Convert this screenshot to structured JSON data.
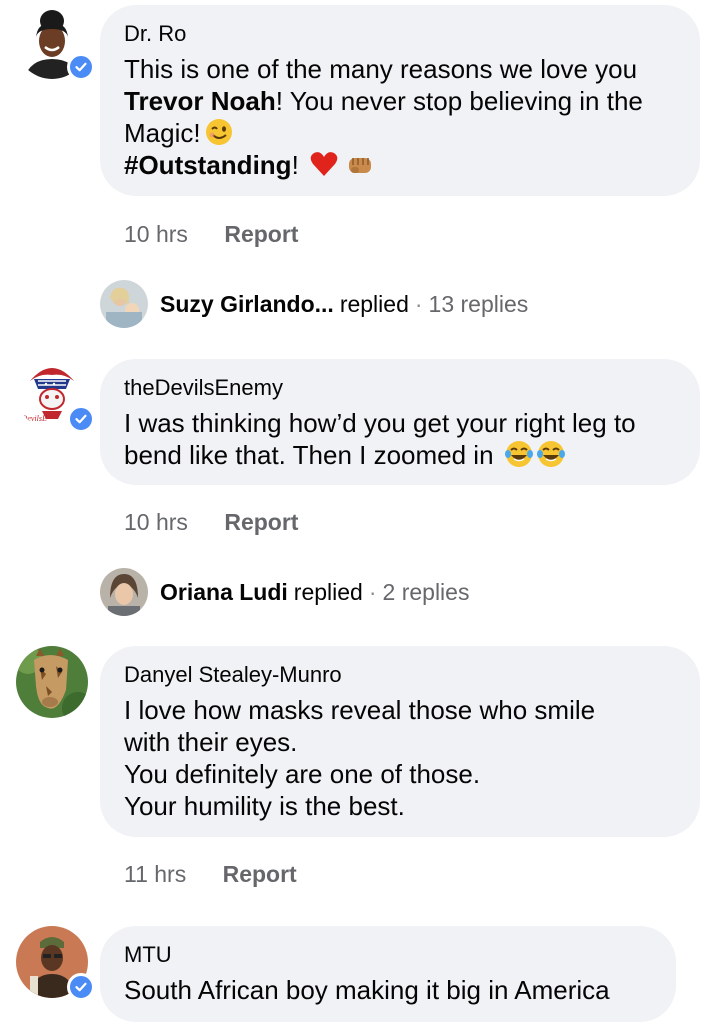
{
  "comments": [
    {
      "author": "Dr. Ro",
      "verified": true,
      "lines": [
        {
          "pre": "This is one of the many reasons we love you ",
          "bold": "",
          "post": ""
        },
        {
          "pre": "",
          "bold": "Trevor Noah",
          "post": "! You never stop believing in the"
        },
        {
          "pre": "Magic!",
          "bold": "",
          "post": ""
        },
        {
          "pre": "",
          "bold": "#Outstanding",
          "post": "!"
        }
      ],
      "emojis": [
        "wink-emoji",
        "red-heart-emoji",
        "fist-emoji"
      ],
      "time": "10 hrs",
      "report": "Report",
      "reply_summary": {
        "name": "Suzy Girlando...",
        "verb": "replied",
        "dot": "·",
        "count": "13 replies"
      }
    },
    {
      "author": "theDevilsEnemy",
      "verified": true,
      "lines": [
        {
          "pre": "I was thinking how’d you get your right leg to"
        },
        {
          "pre": "bend like that. Then I zoomed in"
        }
      ],
      "emojis": [
        "tears-of-joy-emoji",
        "tears-of-joy-emoji"
      ],
      "avatar_text": "eDevilsE",
      "time": "10 hrs",
      "report": "Report",
      "reply_summary": {
        "name": "Oriana Ludi",
        "verb": "replied",
        "dot": "·",
        "count": "2 replies"
      }
    },
    {
      "author": "Danyel Stealey-Munro",
      "verified": false,
      "lines": [
        {
          "pre": "I love how masks reveal those who smile"
        },
        {
          "pre": "with their eyes."
        },
        {
          "pre": "You definitely are one of those."
        },
        {
          "pre": "Your humility is the best."
        }
      ],
      "time": "11 hrs",
      "report": "Report"
    },
    {
      "author": "MTU",
      "verified": true,
      "lines": [
        {
          "pre": "South African boy making it big in America"
        }
      ]
    }
  ],
  "colors": {
    "bubble": "#f0f2f5",
    "verified": "#4a8bf5",
    "meta": "#65676b"
  }
}
